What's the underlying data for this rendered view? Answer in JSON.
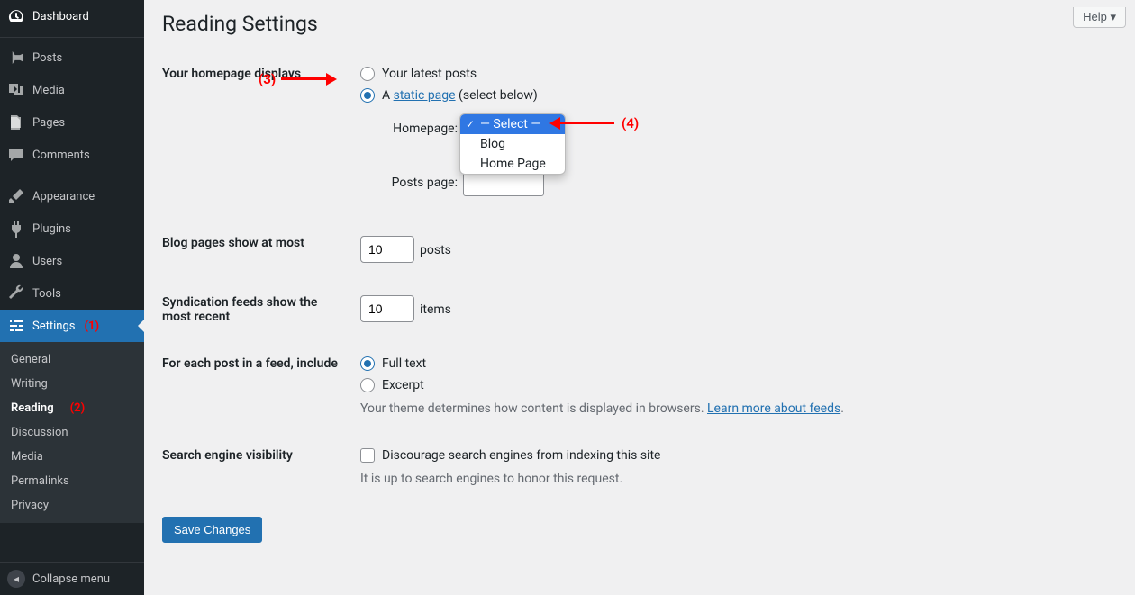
{
  "sidebar": {
    "items": [
      {
        "label": "Dashboard",
        "icon": "dashboard"
      },
      {
        "label": "Posts",
        "icon": "pin"
      },
      {
        "label": "Media",
        "icon": "media"
      },
      {
        "label": "Pages",
        "icon": "pages"
      },
      {
        "label": "Comments",
        "icon": "comment"
      },
      {
        "label": "Appearance",
        "icon": "brush"
      },
      {
        "label": "Plugins",
        "icon": "plug"
      },
      {
        "label": "Users",
        "icon": "user"
      },
      {
        "label": "Tools",
        "icon": "wrench"
      },
      {
        "label": "Settings",
        "icon": "sliders"
      }
    ],
    "submenu": [
      "General",
      "Writing",
      "Reading",
      "Discussion",
      "Media",
      "Permalinks",
      "Privacy"
    ],
    "collapse": "Collapse menu"
  },
  "header": {
    "help": "Help",
    "title": "Reading Settings"
  },
  "form": {
    "homepage_label": "Your homepage displays",
    "radio_latest": "Your latest posts",
    "radio_static_prefix": "A ",
    "radio_static_link": "static page",
    "radio_static_suffix": " (select below)",
    "sel_homepage_label": "Homepage:",
    "sel_posts_label": "Posts page:",
    "dropdown": {
      "selected": "— Select —",
      "opt1": "Blog",
      "opt2": "Home Page"
    },
    "blog_pages_label": "Blog pages show at most",
    "blog_pages_value": "10",
    "blog_pages_suffix": "posts",
    "syndication_label": "Syndication feeds show the most recent",
    "syndication_value": "10",
    "syndication_suffix": "items",
    "feed_label": "For each post in a feed, include",
    "feed_full": "Full text",
    "feed_excerpt": "Excerpt",
    "feed_desc_prefix": "Your theme determines how content is displayed in browsers. ",
    "feed_desc_link": "Learn more about feeds",
    "search_label": "Search engine visibility",
    "search_checkbox": "Discourage search engines from indexing this site",
    "search_desc": "It is up to search engines to honor this request.",
    "save": "Save Changes"
  },
  "annotations": {
    "a1": "(1)",
    "a2": "(2)",
    "a3": "(3)",
    "a4": "(4)"
  }
}
